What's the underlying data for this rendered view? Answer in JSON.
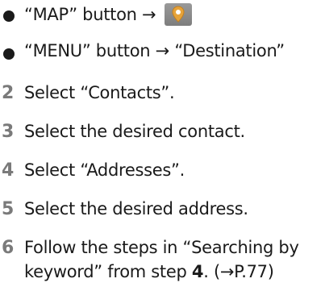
{
  "bullets": [
    {
      "text": "“MAP” button →",
      "icon": "map-pin-button-icon"
    },
    {
      "text": "“MENU” button → “Destination”"
    }
  ],
  "steps": [
    {
      "number": "2",
      "text": "Select “Contacts”."
    },
    {
      "number": "3",
      "text": "Select the desired contact."
    },
    {
      "number": "4",
      "text": "Select “Addresses”."
    },
    {
      "number": "5",
      "text": "Select the desired address."
    },
    {
      "number": "6",
      "line1": "Follow the steps in “Searching by",
      "line2_pre": "keyword” from step ",
      "line2_step": "4",
      "line2_post": ". (→P.77)"
    }
  ],
  "colors": {
    "step_number": "#7a7a7a",
    "map_button": "#8a8a8a",
    "pin": "#e6a33a"
  }
}
